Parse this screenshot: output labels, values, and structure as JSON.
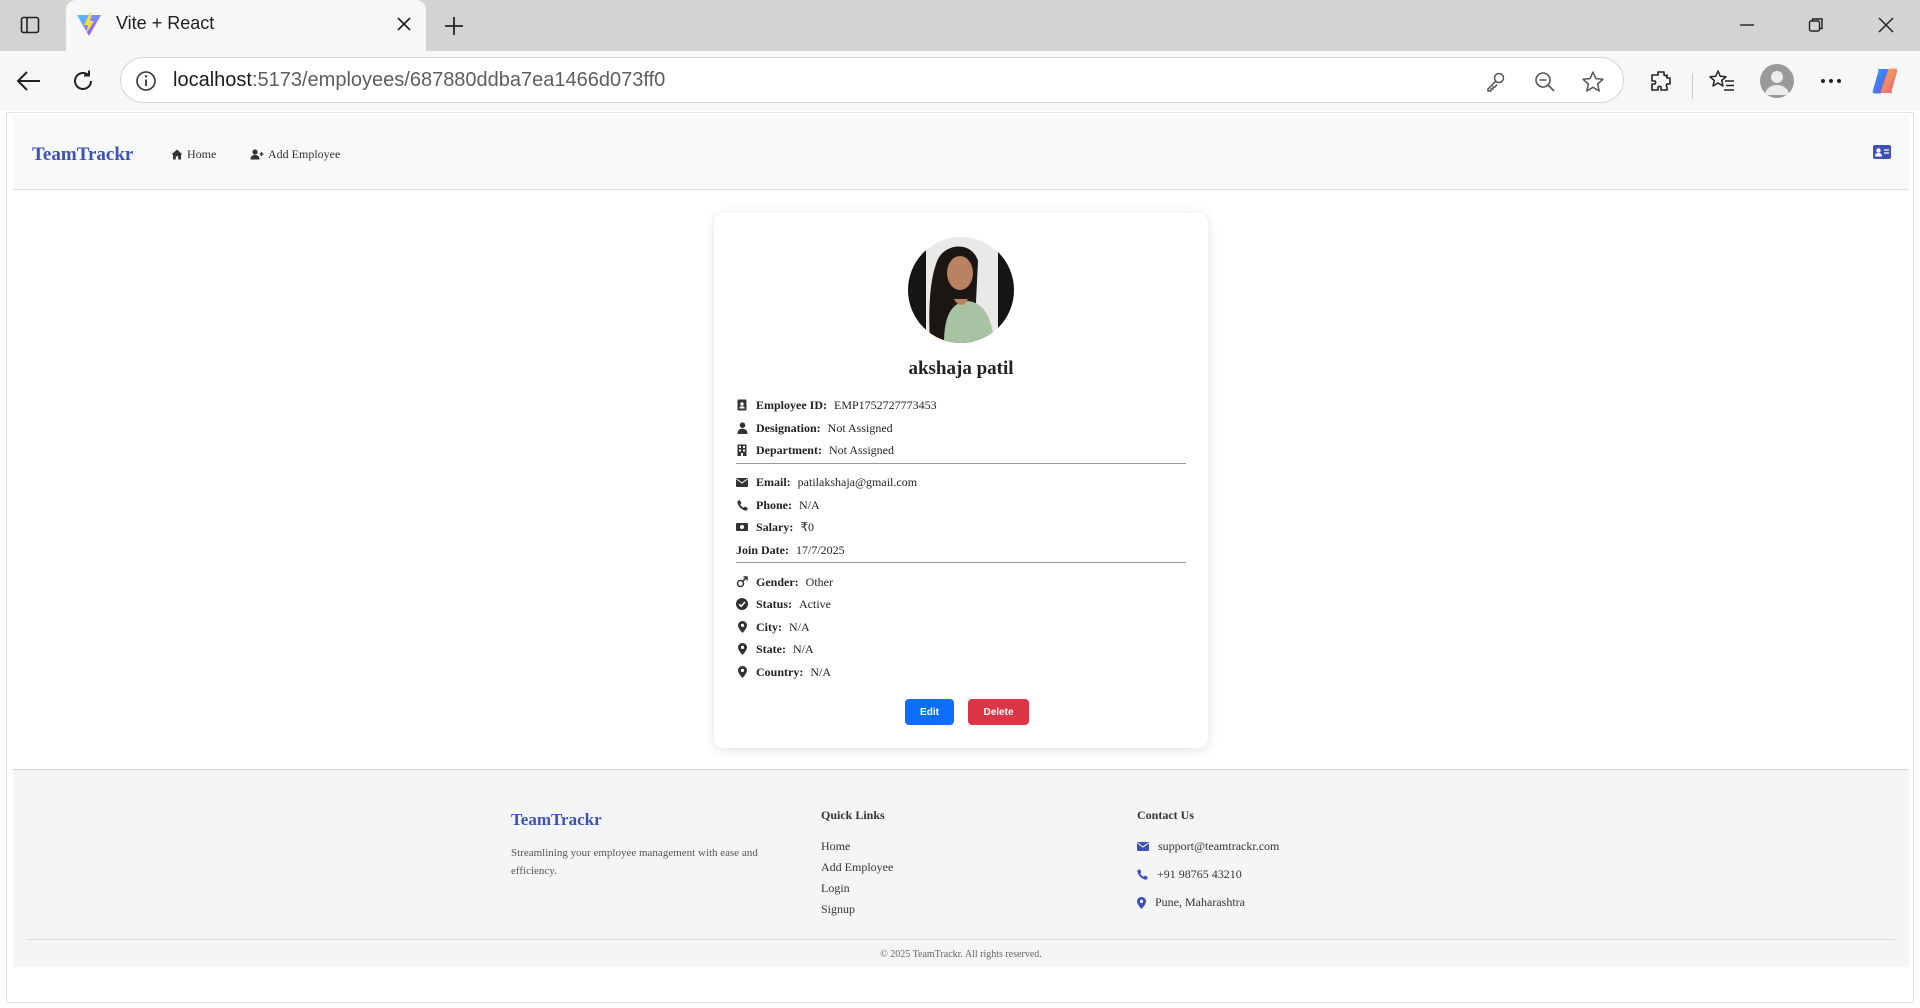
{
  "browser": {
    "tab_title": "Vite + React",
    "url_host": "localhost",
    "url_path": ":5173/employees/687880ddba7ea1466d073ff0"
  },
  "navbar": {
    "brand": "TeamTrackr",
    "links": [
      {
        "label": "Home",
        "icon": "home-icon"
      },
      {
        "label": "Add Employee",
        "icon": "user-plus-icon"
      }
    ]
  },
  "employee": {
    "name": "akshaja patil",
    "details_group1": [
      {
        "label": "Employee ID:",
        "value": "EMP1752727773453",
        "icon": "id-badge-icon"
      },
      {
        "label": "Designation:",
        "value": "Not Assigned",
        "icon": "user-icon"
      },
      {
        "label": "Department:",
        "value": "Not Assigned",
        "icon": "building-icon"
      }
    ],
    "details_group2": [
      {
        "label": "Email:",
        "value": "patilakshaja@gmail.com",
        "icon": "envelope-icon"
      },
      {
        "label": "Phone:",
        "value": "N/A",
        "icon": "phone-icon"
      },
      {
        "label": "Salary:",
        "value": "₹0",
        "icon": "money-icon"
      },
      {
        "label": "Join Date:",
        "value": "17/7/2025",
        "icon": ""
      }
    ],
    "details_group3": [
      {
        "label": "Gender:",
        "value": "Other",
        "icon": "gender-icon"
      },
      {
        "label": "Status:",
        "value": "Active",
        "icon": "check-circle-icon"
      },
      {
        "label": "City:",
        "value": "N/A",
        "icon": "map-pin-icon"
      },
      {
        "label": "State:",
        "value": "N/A",
        "icon": "map-pin-icon"
      },
      {
        "label": "Country:",
        "value": "N/A",
        "icon": "map-pin-icon"
      }
    ],
    "edit_label": "Edit",
    "delete_label": "Delete"
  },
  "footer": {
    "brand": "TeamTrackr",
    "tagline": "Streamlining your employee management with ease and efficiency.",
    "quick_links_heading": "Quick Links",
    "quick_links": [
      "Home",
      "Add Employee",
      "Login",
      "Signup"
    ],
    "contact_heading": "Contact Us",
    "contact": {
      "email": "support@teamtrackr.com",
      "phone": "+91 98765 43210",
      "location": "Pune, Maharashtra"
    },
    "copyright": "© 2025 TeamTrackr. All rights reserved."
  },
  "colors": {
    "brand": "#3f51b5",
    "edit_button": "#0d6efd",
    "delete_button": "#dc3545"
  }
}
